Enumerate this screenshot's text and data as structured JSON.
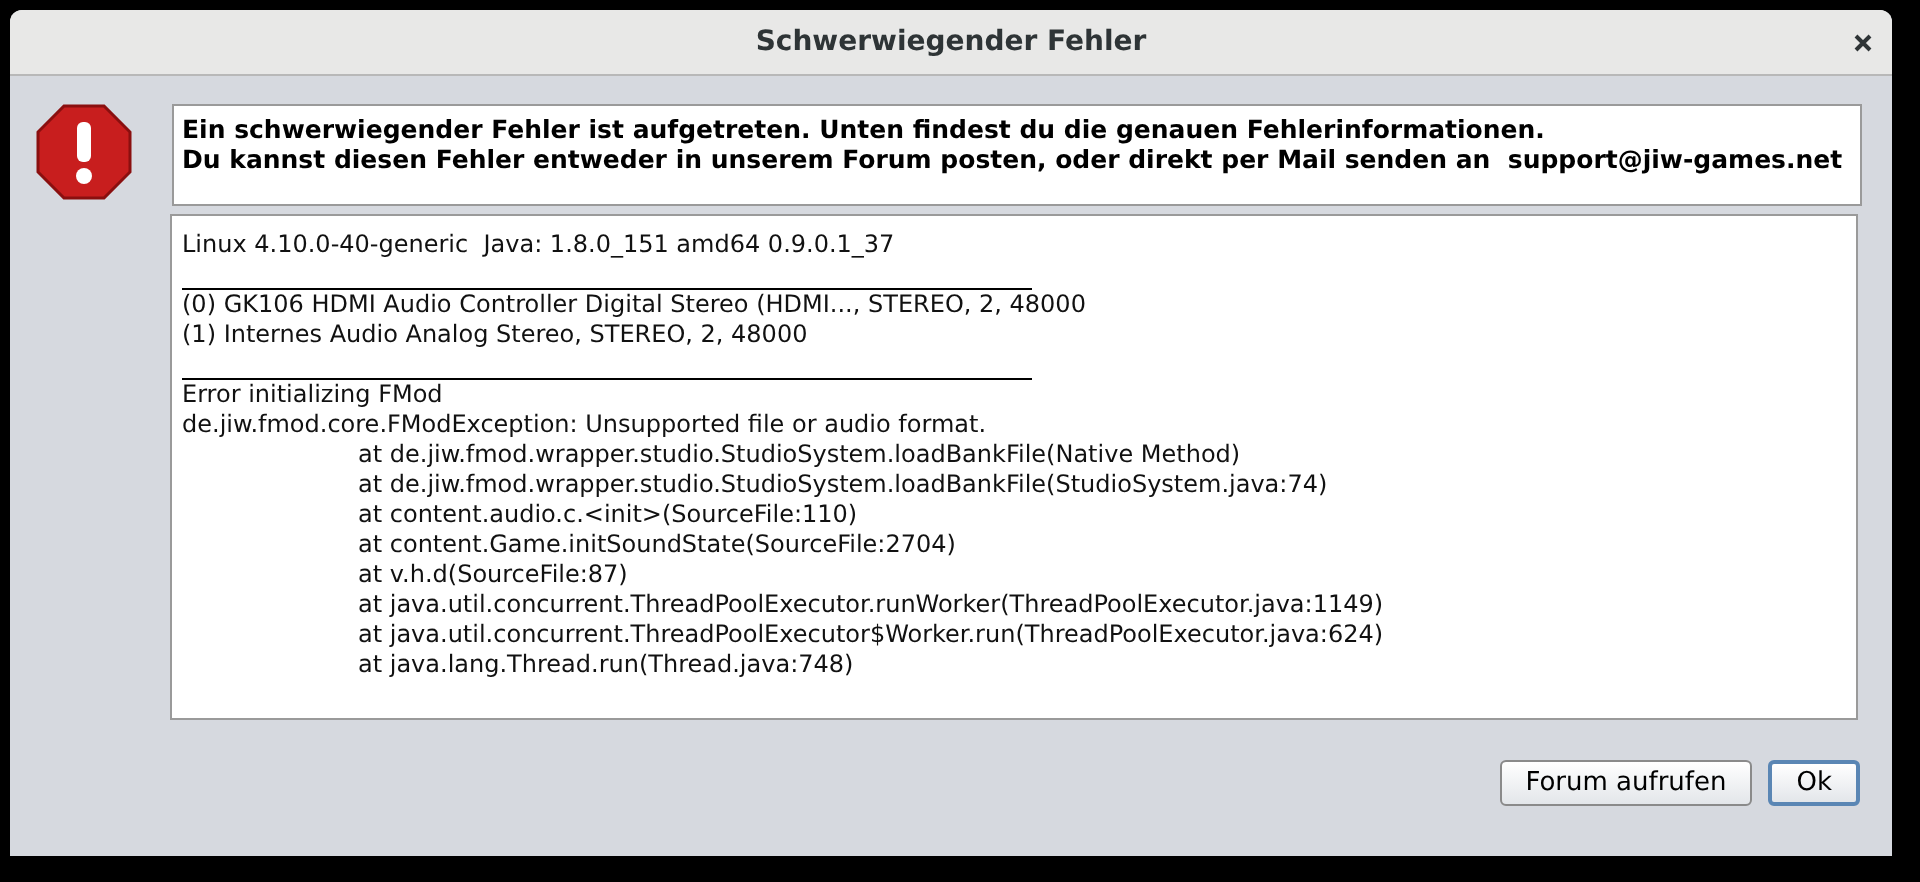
{
  "window": {
    "title": "Schwerwiegender Fehler"
  },
  "message": [
    "Ein schwerwiegender Fehler ist aufgetreten. Unten findest du die genauen Fehlerinformationen.",
    "Du kannst diesen Fehler entweder in unserem Forum posten, oder direkt per Mail senden an  support@jiw-games.net"
  ],
  "log": [
    {
      "kind": "text",
      "text": "Linux 4.10.0-40-generic  Java: 1.8.0_151 amd64 0.9.0.1_37"
    },
    {
      "kind": "rule"
    },
    {
      "kind": "text",
      "text": "(0) GK106 HDMI Audio Controller Digital Stereo (HDMI..., STEREO, 2, 48000"
    },
    {
      "kind": "text",
      "text": "(1) Internes Audio Analog Stereo, STEREO, 2, 48000"
    },
    {
      "kind": "rule"
    },
    {
      "kind": "text",
      "text": "Error initializing FMod"
    },
    {
      "kind": "text",
      "text": "de.jiw.fmod.core.FModException: Unsupported file or audio format."
    },
    {
      "kind": "trace",
      "text": "at de.jiw.fmod.wrapper.studio.StudioSystem.loadBankFile(Native Method)"
    },
    {
      "kind": "trace",
      "text": "at de.jiw.fmod.wrapper.studio.StudioSystem.loadBankFile(StudioSystem.java:74)"
    },
    {
      "kind": "trace",
      "text": "at content.audio.c.<init>(SourceFile:110)"
    },
    {
      "kind": "trace",
      "text": "at content.Game.initSoundState(SourceFile:2704)"
    },
    {
      "kind": "trace",
      "text": "at v.h.d(SourceFile:87)"
    },
    {
      "kind": "trace",
      "text": "at java.util.concurrent.ThreadPoolExecutor.runWorker(ThreadPoolExecutor.java:1149)"
    },
    {
      "kind": "trace",
      "text": "at java.util.concurrent.ThreadPoolExecutor$Worker.run(ThreadPoolExecutor.java:624)"
    },
    {
      "kind": "trace",
      "text": "at java.lang.Thread.run(Thread.java:748)"
    }
  ],
  "buttons": [
    {
      "label": "Forum aufrufen",
      "focused": false
    },
    {
      "label": "Ok",
      "focused": true
    }
  ]
}
